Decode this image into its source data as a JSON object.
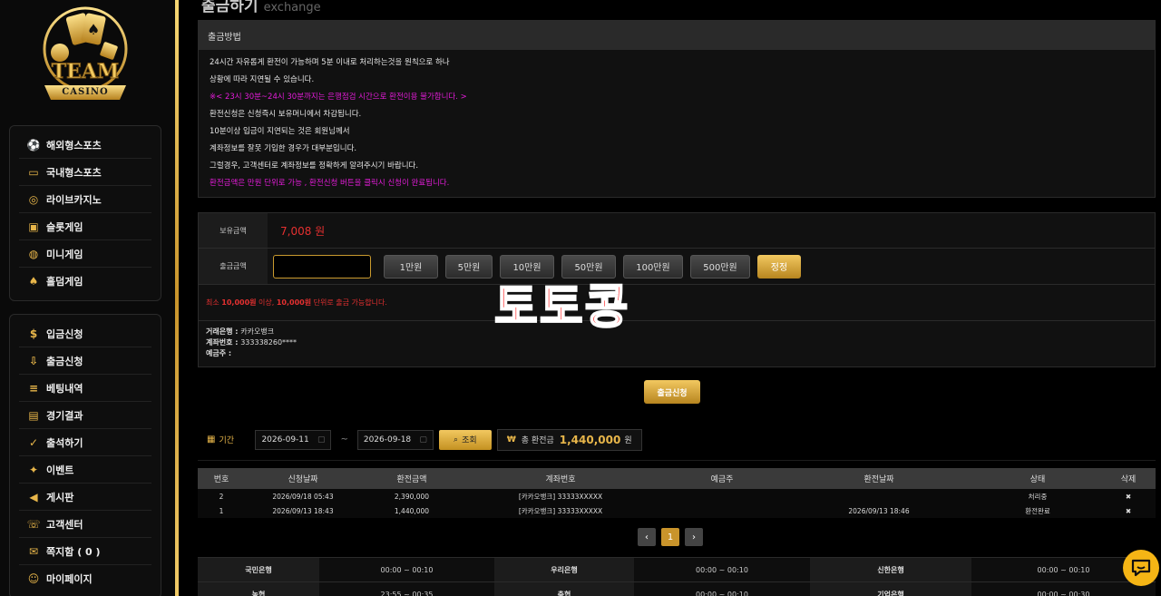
{
  "logo": {
    "text_top": "TEAM",
    "text_bottom": "CASINO"
  },
  "sidebar": {
    "group1": [
      {
        "label": "해외형스포츠",
        "icon": "soccer-ball-icon"
      },
      {
        "label": "국내형스포츠",
        "icon": "ticket-icon"
      },
      {
        "label": "라이브카지노",
        "icon": "chip-icon"
      },
      {
        "label": "슬롯게임",
        "icon": "slot-machine-icon"
      },
      {
        "label": "미니게임",
        "icon": "gamepad-icon"
      },
      {
        "label": "홀덤게임",
        "icon": "spade-icon"
      }
    ],
    "group2": [
      {
        "label": "입금신청",
        "icon": "coin-icon"
      },
      {
        "label": "출금신청",
        "icon": "withdraw-icon"
      },
      {
        "label": "베팅내역",
        "icon": "list-icon"
      },
      {
        "label": "경기결과",
        "icon": "scoreboard-icon"
      },
      {
        "label": "출석하기",
        "icon": "calendar-check-icon"
      },
      {
        "label": "이벤트",
        "icon": "gift-icon"
      },
      {
        "label": "게시판",
        "icon": "megaphone-icon"
      },
      {
        "label": "고객센터",
        "icon": "headset-icon"
      },
      {
        "label": "쪽지함 ( 0 )",
        "icon": "mail-icon"
      },
      {
        "label": "마이페이지",
        "icon": "user-icon"
      }
    ]
  },
  "page": {
    "title": "출금하기",
    "subtitle": "exchange"
  },
  "notice": {
    "heading": "출금방법",
    "lines": [
      {
        "text": "24시간 자유롭게 환전이 가능하며 5분 이내로 처리하는것을 원칙으로 하나",
        "pink": false
      },
      {
        "text": "상황에 따라 지연될 수 있습니다.",
        "pink": false
      },
      {
        "text": "※< 23시 30분~24시 30분까지는 은행점검 시간으로 환전이용 불가합니다. >",
        "pink": true
      },
      {
        "text": "환전신청은 신청즉시 보유머니에서 차감됩니다.",
        "pink": false
      },
      {
        "text": "10분이상 입금이 지연되는 것은 회원님께서",
        "pink": false
      },
      {
        "text": "계좌정보를 잘못 기입한 경우가 대부분입니다.",
        "pink": false
      },
      {
        "text": "그럴경우, 고객센터로 계좌정보를 정확하게 알려주시기 바랍니다.",
        "pink": false
      },
      {
        "text": "환전금액은 만원 단위로 가능 , 환전신청 버튼을 클릭시 신청이 완료됩니다.",
        "pink": true
      }
    ]
  },
  "form": {
    "balance_label": "보유금액",
    "balance_value": "7,008 원",
    "amount_label": "출금금액",
    "amount_value": "",
    "amount_buttons": [
      "1만원",
      "5만원",
      "10만원",
      "50만원",
      "100만원",
      "500만원"
    ],
    "reset_label": "정정",
    "min_notice_prefix": "최소 ",
    "min_notice_bold1": "10,000원",
    "min_notice_mid": " 이상, ",
    "min_notice_bold2": "10,000원",
    "min_notice_suffix": " 단위로 출금 가능합니다.",
    "bank_label": "거래은행 : ",
    "bank_value": "카카오뱅크",
    "account_label": "계좌번호 : ",
    "account_value": "333338260****",
    "holder_label": "예금주 : ",
    "holder_value": ""
  },
  "watermark": "토토콩",
  "submit_label": "출금신청",
  "search": {
    "period_label": "기간",
    "date_from": "2026-09-11",
    "date_to": "2026-09-18",
    "tilde": "~",
    "search_label": "조회",
    "won_symbol": "₩",
    "total_label": "총 환전금",
    "total_value": "1,440,000",
    "total_unit": "원"
  },
  "history": {
    "headers": [
      "번호",
      "신청날짜",
      "환전금액",
      "계좌번호",
      "예금주",
      "환전날짜",
      "상태",
      "삭제"
    ],
    "rows": [
      {
        "no": "2",
        "date": "2026/09/18 05:43",
        "amount": "2,390,000",
        "account": "[카카오뱅크] 33333XXXXX",
        "holder": "",
        "done": "",
        "status": "처리중",
        "del": "✖"
      },
      {
        "no": "1",
        "date": "2026/09/13 18:43",
        "amount": "1,440,000",
        "account": "[카카오뱅크] 33333XXXXX",
        "holder": "",
        "done": "2026/09/13 18:46",
        "status": "환전완료",
        "del": "✖"
      }
    ]
  },
  "pager": {
    "prev": "‹",
    "current": "1",
    "next": "›"
  },
  "banks": [
    [
      {
        "name": "국민은행",
        "time": "00:00 ~ 00:10"
      },
      {
        "name": "우리은행",
        "time": "00:00 ~ 00:10"
      },
      {
        "name": "신한은행",
        "time": "00:00 ~ 00:10"
      }
    ],
    [
      {
        "name": "농협",
        "time": "23:55 ~ 00:35"
      },
      {
        "name": "축협",
        "time": "00:00 ~ 00:10"
      },
      {
        "name": "기업은행",
        "time": "00:00 ~ 00:30"
      }
    ]
  ],
  "colors": {
    "gold": "#e8b64a",
    "pink": "#e21cd7",
    "red": "#e53030"
  }
}
